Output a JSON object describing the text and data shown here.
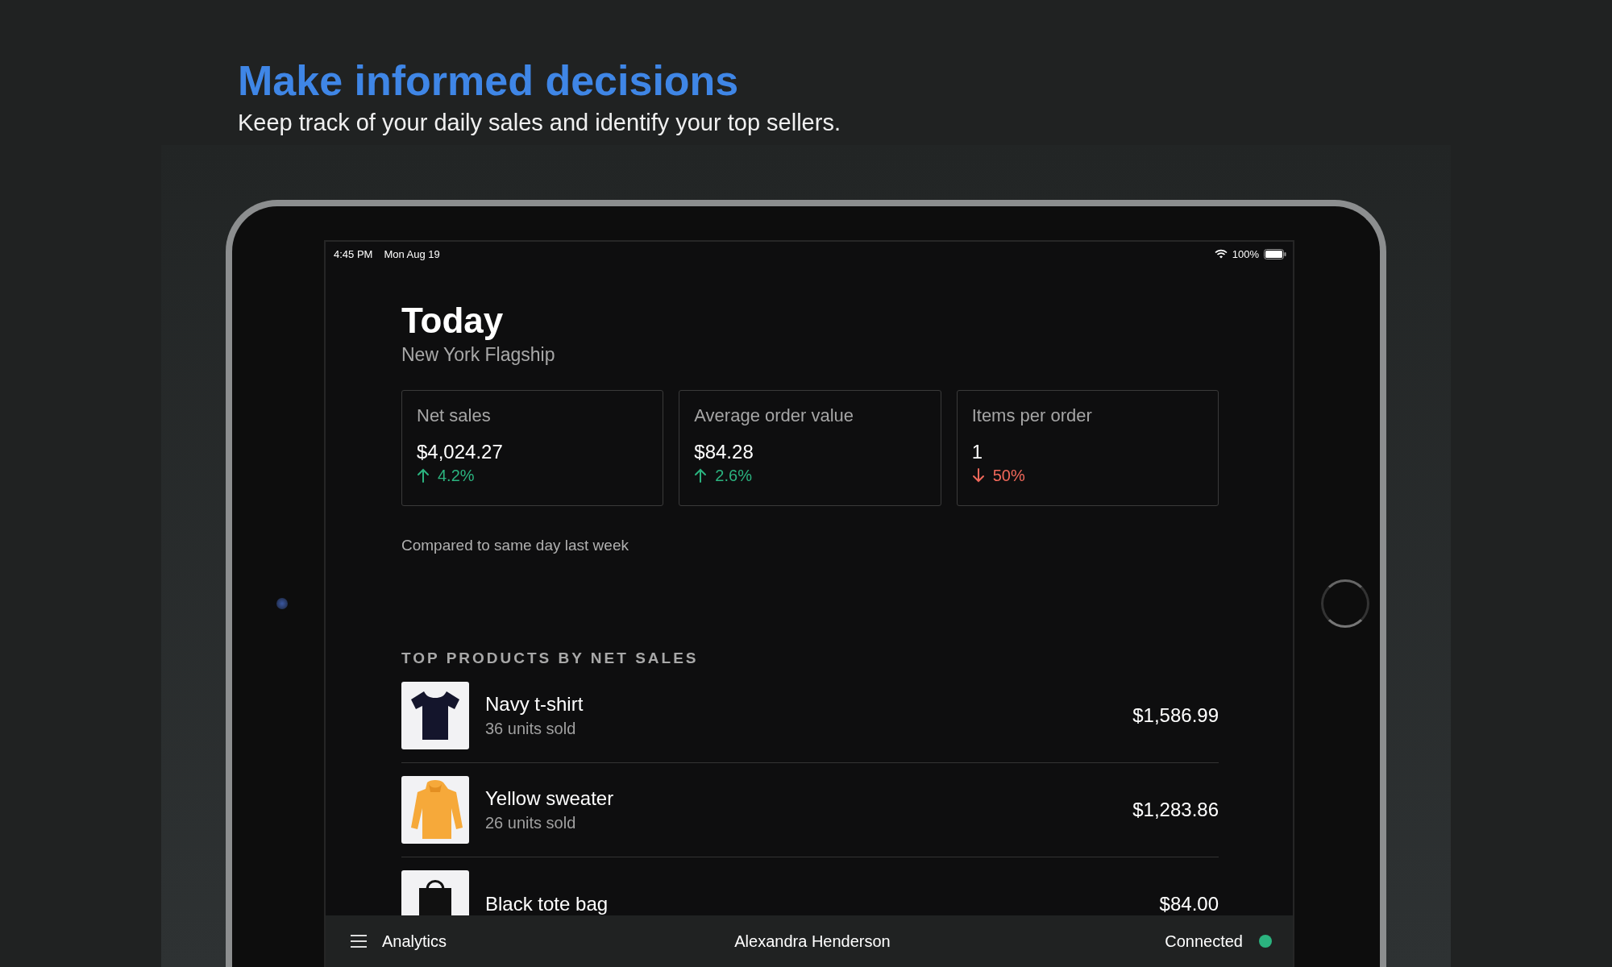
{
  "headline": "Make informed decisions",
  "subheadline": "Keep track of your daily sales and identify your top sellers.",
  "status_bar": {
    "time": "4:45 PM",
    "date": "Mon Aug 19",
    "battery": "100%"
  },
  "title": "Today",
  "location": "New York Flagship",
  "metrics": [
    {
      "label": "Net sales",
      "value": "$4,024.27",
      "change": "4.2%",
      "increase": true
    },
    {
      "label": "Average order value",
      "value": "$84.28",
      "change": "2.6%",
      "increase": true
    },
    {
      "label": "Items per order",
      "value": "1",
      "change": "50%",
      "increase": false
    }
  ],
  "comparison_note": "Compared to same day last week",
  "section_title": "TOP PRODUCTS BY NET SALES",
  "products": [
    {
      "name": "Navy t-shirt",
      "units": "36 units sold",
      "amount": "$1,586.99"
    },
    {
      "name": "Yellow sweater",
      "units": "26 units sold",
      "amount": "$1,283.86"
    },
    {
      "name": "Black tote bag",
      "amount": "$84.00"
    }
  ],
  "bottom_bar": {
    "section": "Analytics",
    "user": "Alexandra Henderson",
    "status": "Connected",
    "connected": true
  }
}
